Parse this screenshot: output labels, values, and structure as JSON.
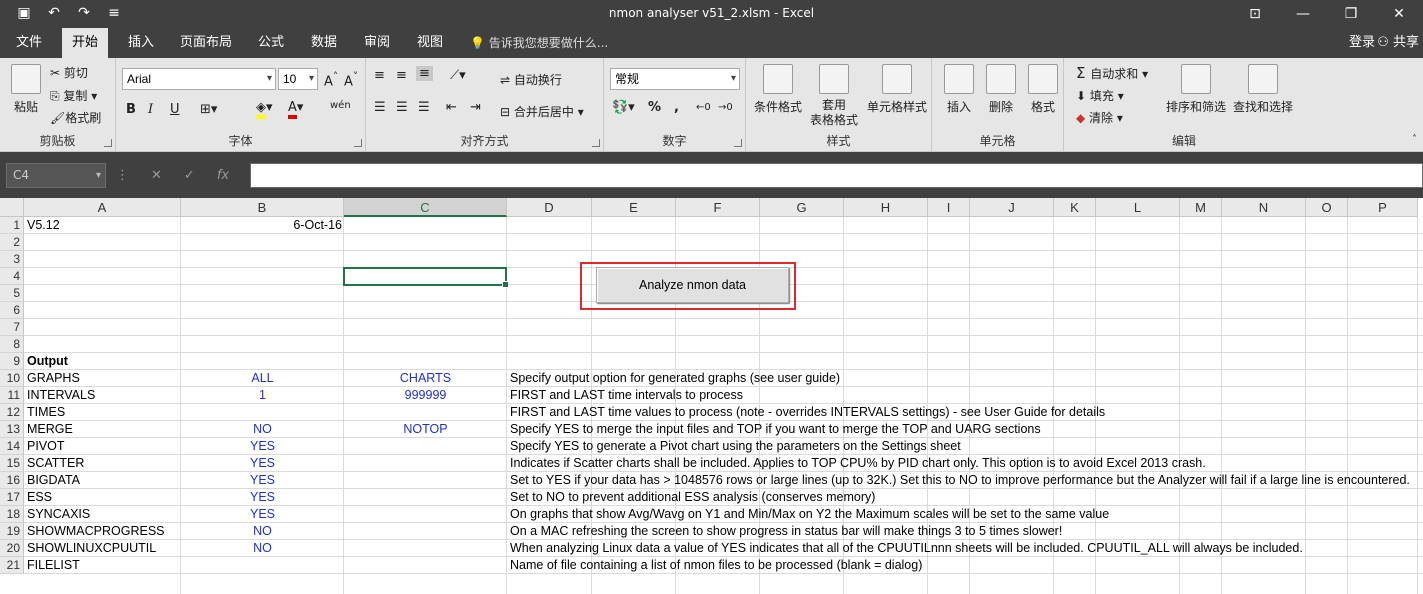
{
  "window": {
    "title": "nmon analyser v51_2.xlsm  -  Excel",
    "qat": {
      "save_icon": "save-icon",
      "undo_icon": "undo-icon",
      "redo_icon": "redo-icon",
      "customize_icon": "customize-qat-icon"
    },
    "controls": {
      "ribbon_display": "ribbon-display-icon",
      "minimize": "minimize-icon",
      "restore": "restore-icon",
      "close": "close-icon"
    }
  },
  "tabs": [
    "文件",
    "开始",
    "插入",
    "页面布局",
    "公式",
    "数据",
    "审阅",
    "视图"
  ],
  "active_tab": "开始",
  "tell_me": "告诉我您想要做什么...",
  "login": "登录",
  "share": "共享",
  "ribbon": {
    "clipboard": {
      "label": "剪贴板",
      "paste": "粘贴",
      "cut": "剪切",
      "copy": "复制",
      "format_painter": "格式刷"
    },
    "font": {
      "label": "字体",
      "font_name": "Arial",
      "font_size": "10",
      "bold": "B",
      "italic": "I",
      "underline": "U",
      "wen": "wén"
    },
    "alignment": {
      "label": "对齐方式",
      "wrap": "自动换行",
      "merge": "合并后居中"
    },
    "number": {
      "label": "数字",
      "format": "常规",
      "percent": "%",
      "comma": ","
    },
    "styles": {
      "label": "样式",
      "cond_format": "条件格式",
      "table_format_1": "套用",
      "table_format_2": "表格格式",
      "cell_styles": "单元格样式"
    },
    "cells": {
      "label": "单元格",
      "insert": "插入",
      "delete": "删除",
      "format": "格式"
    },
    "editing": {
      "label": "编辑",
      "autosum": "自动求和",
      "fill": "填充",
      "clear": "清除",
      "sort_filter": "排序和筛选",
      "find_select": "查找和选择"
    }
  },
  "formula_bar": {
    "name_box": "C4",
    "fx": "fx",
    "formula": ""
  },
  "columns": [
    "A",
    "B",
    "C",
    "D",
    "E",
    "F",
    "G",
    "H",
    "I",
    "J",
    "K",
    "L",
    "M",
    "N",
    "O",
    "P"
  ],
  "selected_column": "C",
  "rows": [
    "1",
    "2",
    "3",
    "4",
    "5",
    "6",
    "7",
    "8",
    "9",
    "10",
    "11",
    "12",
    "13",
    "14",
    "15",
    "16",
    "17",
    "18",
    "19",
    "20",
    "21"
  ],
  "cells": {
    "A1": "V5.12",
    "B1": "6-Oct-16",
    "A9": "Output",
    "A10": "GRAPHS",
    "B10": "ALL",
    "C10": "CHARTS",
    "D10": "Specify output option for generated graphs (see user guide)",
    "A11": "INTERVALS",
    "B11": "1",
    "C11": "999999",
    "D11": "FIRST and LAST time intervals to process",
    "A12": "TIMES",
    "D12": "FIRST and LAST time values to process (note - overrides INTERVALS settings) - see User Guide for details",
    "A13": "MERGE",
    "B13": "NO",
    "C13": "NOTOP",
    "D13": "Specify YES to merge the input files and TOP if you want to merge the TOP and UARG sections",
    "A14": "PIVOT",
    "B14": "YES",
    "D14": "Specify YES to generate a Pivot chart using the parameters on the Settings sheet",
    "A15": "SCATTER",
    "B15": "YES",
    "D15": "Indicates if Scatter charts shall be included.  Applies to TOP CPU% by PID chart only.  This option is to avoid Excel 2013 crash.",
    "A16": "BIGDATA",
    "B16": "YES",
    "D16": "Set to YES if your data has > 1048576 rows or large lines (up to 32K.)  Set this to NO to improve performance but the Analyzer will fail if a large line is encountered.",
    "A17": "ESS",
    "B17": "YES",
    "D17": "Set to NO to prevent additional ESS analysis (conserves memory)",
    "A18": "SYNCAXIS",
    "B18": "YES",
    "D18": "On graphs that show Avg/Wavg on Y1 and Min/Max on Y2 the Maximum scales will be set to the same value",
    "A19": "SHOWMACPROGRESS",
    "B19": "NO",
    "D19": "On a MAC refreshing the screen to show progress in status bar will make things 3 to 5 times slower!",
    "A20": "SHOWLINUXCPUUTIL",
    "B20": "NO",
    "D20": "When analyzing Linux data a value of YES indicates that all of the CPUUTILnnn sheets will be included.  CPUUTIL_ALL will always be included.",
    "A21": "FILELIST",
    "D21": "Name of file containing a list of nmon files to be processed (blank = dialog)"
  },
  "macro_button": "Analyze nmon data"
}
